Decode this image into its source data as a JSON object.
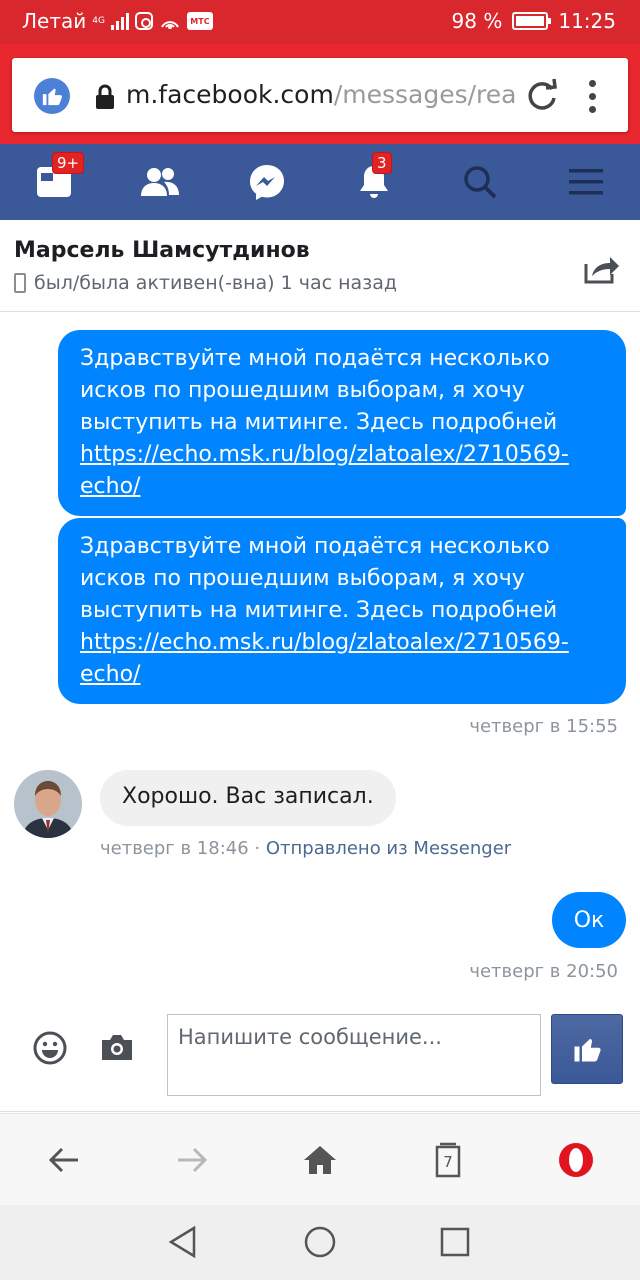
{
  "status_bar": {
    "carrier": "Летай",
    "network": "4G",
    "battery": "98 %",
    "time": "11:25",
    "icons": [
      "signal-icon",
      "instagram-icon",
      "nfc-icon",
      "mts-icon",
      "battery-icon"
    ]
  },
  "url_bar": {
    "domain": "m.facebook.com",
    "path": "/messages/rea",
    "icons": [
      "facebook-like-icon",
      "lock-icon",
      "reload-icon",
      "more-vert-icon"
    ]
  },
  "fb_nav": {
    "badges": {
      "home": "9+",
      "notifications": "3"
    },
    "icons": [
      "news-feed-icon",
      "friends-icon",
      "messenger-icon",
      "notifications-icon",
      "search-icon",
      "menu-icon"
    ]
  },
  "conversation": {
    "name": "Марсель Шамсутдинов",
    "status": "был/была активен(-вна) 1 час назад"
  },
  "messages": [
    {
      "text": "Здравствуйте мной подаётся несколько исков по прошедшим выборам, я хочу выступить на митинге. Здесь подробней ",
      "link": "https://echo.msk.ru/blog/zlatoalex/2710569-echo/"
    },
    {
      "text": "Здравствуйте мной подаётся несколько исков по прошедшим выборам, я хочу выступить на митинге. Здесь подробней ",
      "link": "https://echo.msk.ru/blog/zlatoalex/2710569-echo/"
    }
  ],
  "timestamp1": "четверг в 15:55",
  "incoming": {
    "text": "Хорошо. Вас записал.",
    "time": "четверг в 18:46",
    "separator": " · ",
    "via": "Отправлено из Messenger"
  },
  "reply": {
    "text": "Ок",
    "time": "четверг в 20:50"
  },
  "composer": {
    "placeholder": "Напишите сообщение..."
  },
  "browser_bar": {
    "tabs_count": "7"
  },
  "colors": {
    "status_bar": "#d9272e",
    "facebook_blue": "#3b5998",
    "messenger_blue": "#0084ff",
    "opera_red": "#e0141e"
  }
}
